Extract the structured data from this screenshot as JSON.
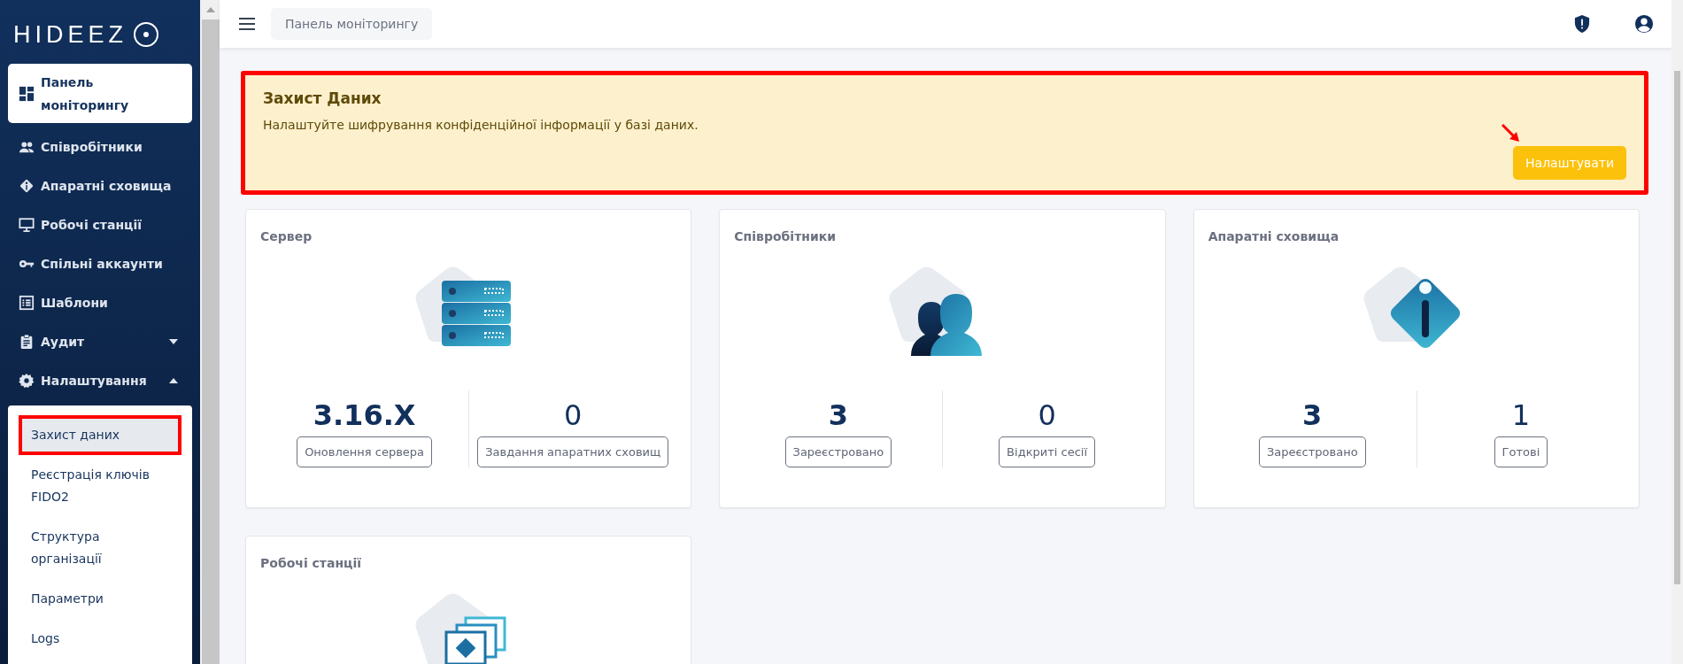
{
  "logo": {
    "text": "HIDEEZ"
  },
  "sidebar": {
    "items": [
      {
        "label": "Панель моніторингу",
        "selected": true
      },
      {
        "label": "Співробітники",
        "selected": false
      },
      {
        "label": "Апаратні сховища",
        "selected": false
      },
      {
        "label": "Робочі станції",
        "selected": false
      },
      {
        "label": "Спільні аккаунти",
        "selected": false
      },
      {
        "label": "Шаблони",
        "selected": false
      },
      {
        "label": "Аудит",
        "selected": false,
        "expanded": false
      },
      {
        "label": "Налаштування",
        "selected": false,
        "expanded": true,
        "children": [
          {
            "label": "Захист даних",
            "selected": true,
            "highlighted": true
          },
          {
            "label": "Реєстрація ключів FIDO2",
            "selected": false,
            "highlighted": false
          },
          {
            "label": "Структура організації",
            "selected": false,
            "highlighted": false
          },
          {
            "label": "Параметри",
            "selected": false,
            "highlighted": false
          },
          {
            "label": "Logs",
            "selected": false,
            "highlighted": false
          }
        ]
      }
    ]
  },
  "topbar": {
    "breadcrumb": "Панель моніторингу"
  },
  "banner": {
    "title": "Захист Даних",
    "text": "Налаштуйте шифрування конфіденційної інформації у базі даних.",
    "button": "Налаштувати",
    "highlighted": true,
    "annotation_arrow": true
  },
  "cards": [
    {
      "title": "Сервер",
      "stats": [
        {
          "value": "3.16.X",
          "label": "Оновлення сервера"
        },
        {
          "value": "0",
          "label": "Завдання апаратних сховищ"
        }
      ]
    },
    {
      "title": "Співробітники",
      "stats": [
        {
          "value": "3",
          "label": "Зареєстровано"
        },
        {
          "value": "0",
          "label": "Відкриті сесії"
        }
      ]
    },
    {
      "title": "Апаратні сховища",
      "stats": [
        {
          "value": "3",
          "label": "Зареєстровано"
        },
        {
          "value": "1",
          "label": "Готові"
        }
      ]
    },
    {
      "title": "Робочі станції"
    }
  ]
}
